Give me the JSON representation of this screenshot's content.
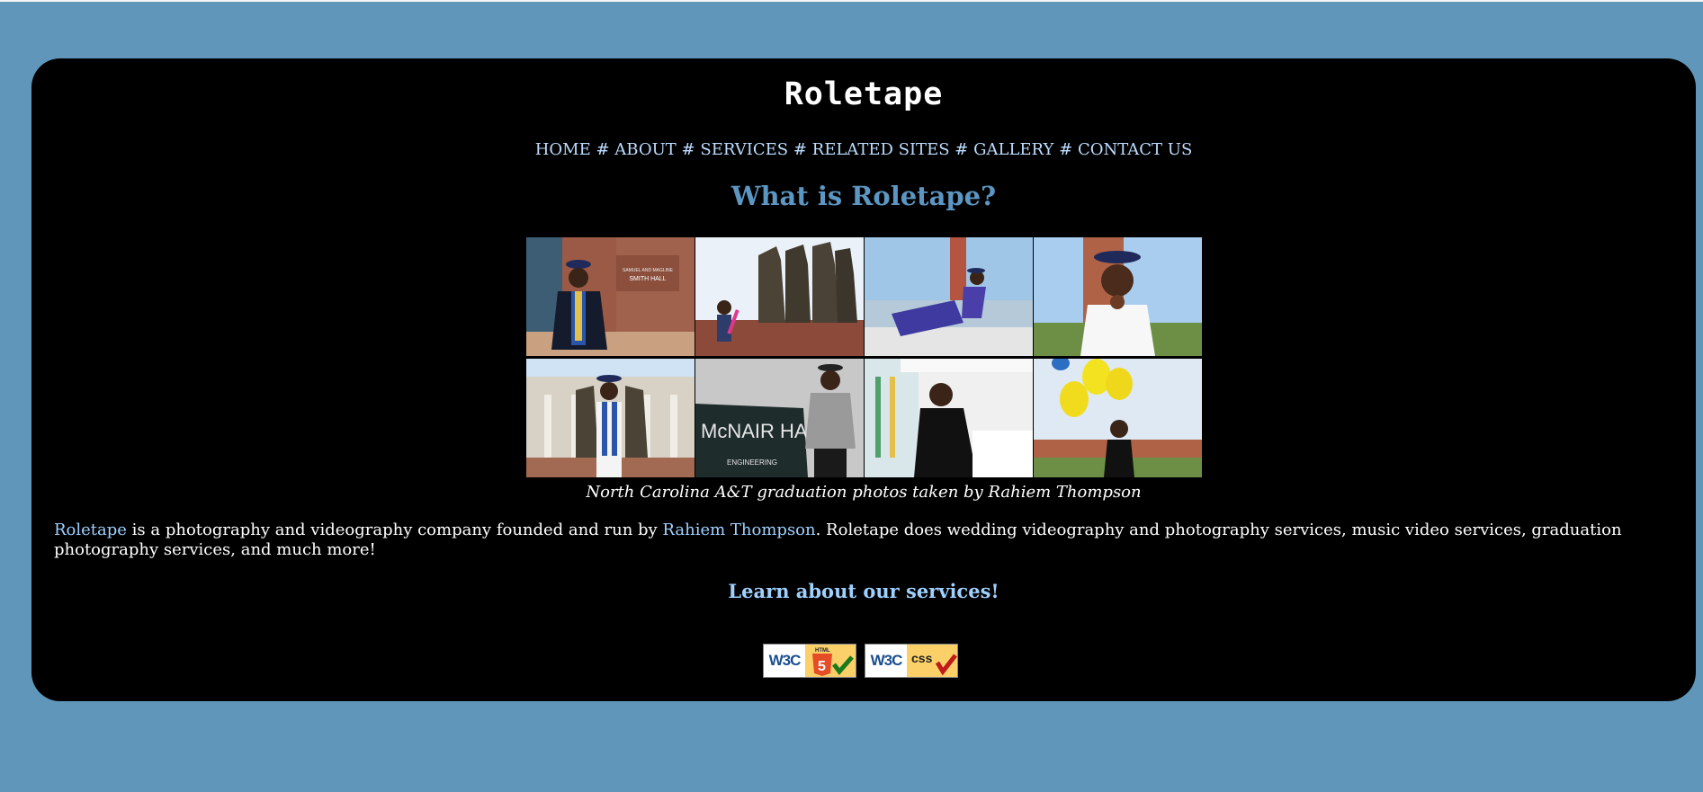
{
  "site": {
    "title": "Roletape"
  },
  "nav": {
    "items": [
      "HOME",
      "ABOUT",
      "SERVICES",
      "RELATED SITES",
      "GALLERY",
      "CONTACT US"
    ],
    "separator": "#"
  },
  "main": {
    "heading": "What is Roletape?",
    "caption": "North Carolina A&T graduation photos taken by Rahiem Thompson",
    "intro": {
      "link1": "Roletape",
      "text1": " is a photography and videography company founded and run by ",
      "link2": "Rahiem Thompson",
      "text2": ". Roletape does wedding videography and photography services, music video services, graduation photography services, and much more!"
    },
    "services_link": "Learn about our services!"
  },
  "badges": {
    "html": {
      "brand": "W3C",
      "label": "HTML",
      "num": "5"
    },
    "css": {
      "brand": "W3C",
      "label": "css"
    }
  },
  "photo_text": {
    "smith_hall_1": "SAMUEL AND MAGLINE",
    "smith_hall_2": "SMITH HALL",
    "mcnair": "McNAIR HALL",
    "engineering": "ENGINEERING"
  },
  "colors": {
    "background": "#6196bb",
    "card": "#000000",
    "heading": "#5c96c2",
    "link": "#9fd1ff"
  }
}
